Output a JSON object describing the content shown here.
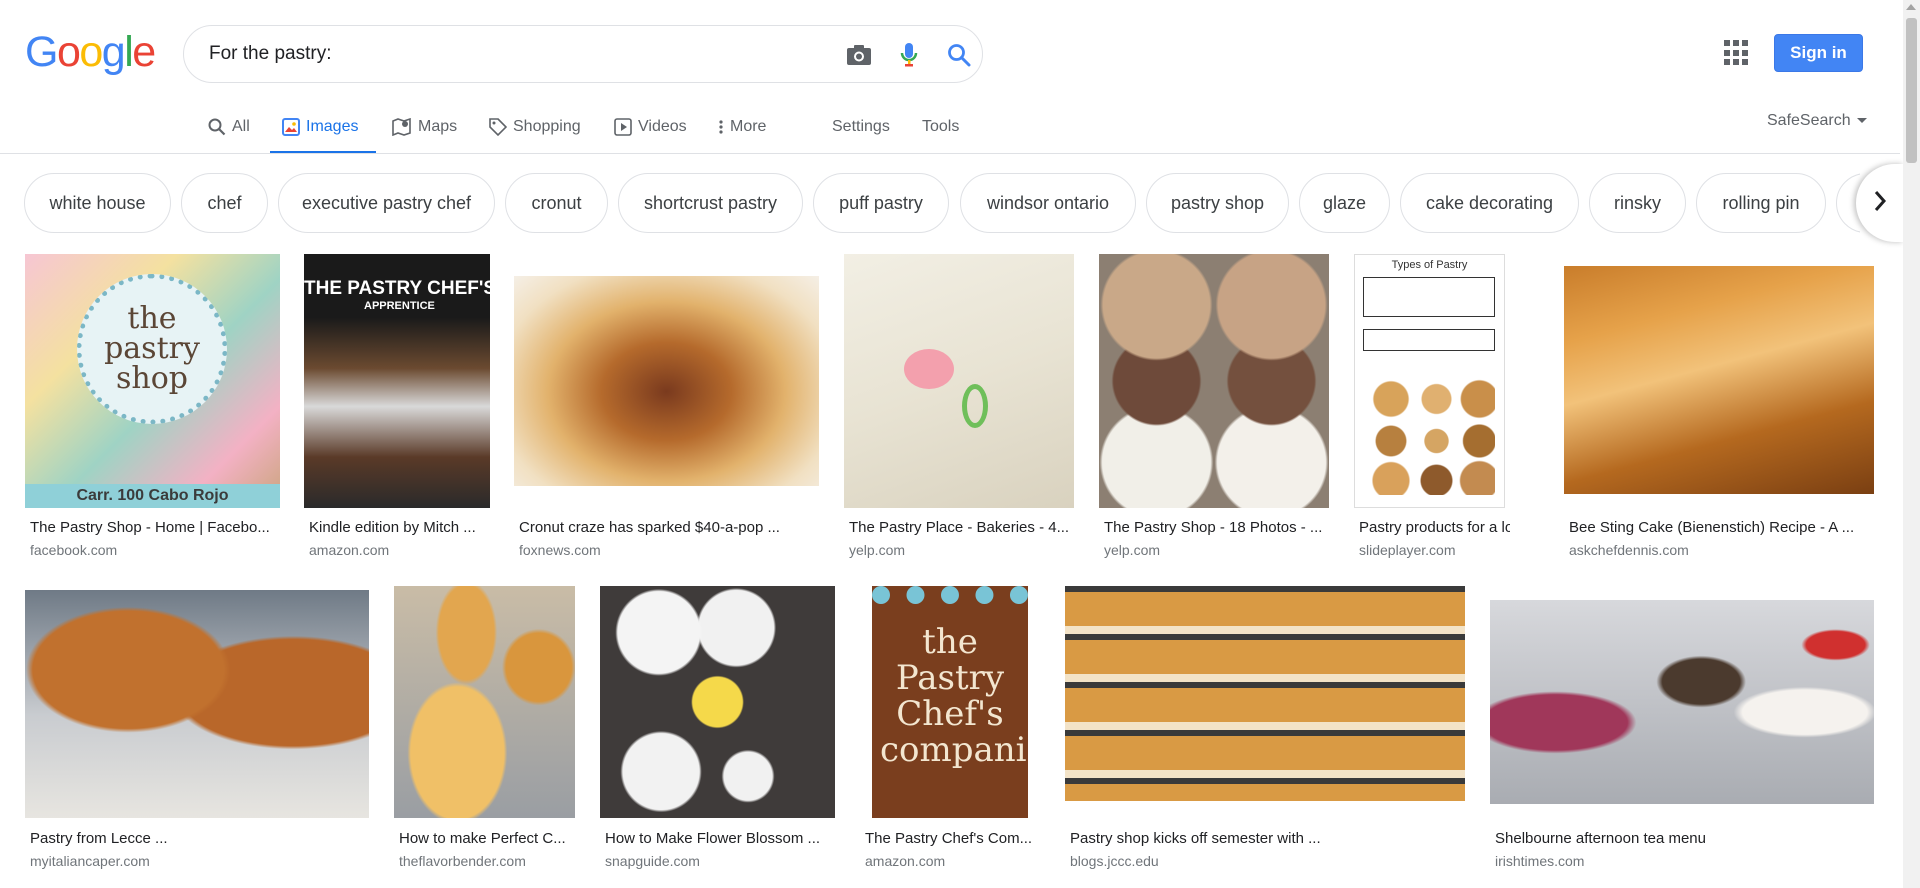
{
  "logo": {
    "letters": [
      "G",
      "o",
      "o",
      "g",
      "l",
      "e"
    ],
    "colors": [
      "#4285f4",
      "#ea4335",
      "#fbbc05",
      "#4285f4",
      "#34a853",
      "#ea4335"
    ]
  },
  "search": {
    "query": "For the pastry:"
  },
  "header": {
    "signin_label": "Sign in"
  },
  "tabs": [
    {
      "label": "All",
      "icon": "search-icon"
    },
    {
      "label": "Images",
      "icon": "image-icon",
      "active": true
    },
    {
      "label": "Maps",
      "icon": "map-icon"
    },
    {
      "label": "Shopping",
      "icon": "tag-icon"
    },
    {
      "label": "Videos",
      "icon": "play-icon"
    },
    {
      "label": "More",
      "icon": "more-vert-icon"
    },
    {
      "label": "Settings"
    },
    {
      "label": "Tools"
    }
  ],
  "safesearch_label": "SafeSearch",
  "chips": [
    "white house",
    "chef",
    "executive pastry chef",
    "cronut",
    "shortcrust pastry",
    "puff pastry",
    "windsor ontario",
    "pastry shop",
    "glaze",
    "cake decorating",
    "rinsky",
    "rolling pin"
  ],
  "results": [
    {
      "title": "The Pastry Shop - Home | Facebo...",
      "source": "facebook.com",
      "image": "pastry-shop-logo-macarons",
      "overlay_text": "the pastry shop",
      "footer_text": "Carr. 100 Cabo Rojo"
    },
    {
      "title": "Kindle edition by Mitch ...",
      "source": "amazon.com",
      "image": "pastry-chefs-apprentice-book-cover",
      "overlay_text": "THE PASTRY CHEF'S",
      "footer_text": "APPRENTICE"
    },
    {
      "title": "Cronut craze has sparked $40-a-pop ...",
      "source": "foxnews.com",
      "image": "cronut-cross-section"
    },
    {
      "title": "The Pastry Place - Bakeries - 4...",
      "source": "yelp.com",
      "image": "white-petit-four-pink-rose"
    },
    {
      "title": "The Pastry Shop - 18 Photos - ...",
      "source": "yelp.com",
      "image": "tray-of-muffins"
    },
    {
      "title": "Pastry products for a lo...",
      "source": "slideplayer.com",
      "image": "types-of-pastry-worksheet",
      "overlay_text": "Types of Pastry"
    },
    {
      "title": "Bee Sting Cake (Bienenstich) Recipe - A ...",
      "source": "askchefdennis.com",
      "image": "almond-bee-sting-cake"
    },
    {
      "title": "Pastry from Lecce ...",
      "source": "myitaliancaper.com",
      "image": "pasticciotti-pastries"
    },
    {
      "title": "How to make Perfect C...",
      "source": "theflavorbender.com",
      "image": "choux-puffs"
    },
    {
      "title": "How to Make Flower Blossom ...",
      "source": "snapguide.com",
      "image": "pastry-ingredients-bowls"
    },
    {
      "title": "The Pastry Chef's Com...",
      "source": "amazon.com",
      "image": "pastry-chefs-companion-book-cover",
      "overlay_text": "the Pastry Chef's companion"
    },
    {
      "title": "Pastry shop kicks off semester with ...",
      "source": "blogs.jccc.edu",
      "image": "bakery-display-case"
    },
    {
      "title": "Shelbourne afternoon tea menu",
      "source": "irishtimes.com",
      "image": "afternoon-tea-desserts"
    }
  ],
  "colors": {
    "accent": "#1a73e8",
    "signin": "#4285f4",
    "muted": "#5f6368"
  }
}
